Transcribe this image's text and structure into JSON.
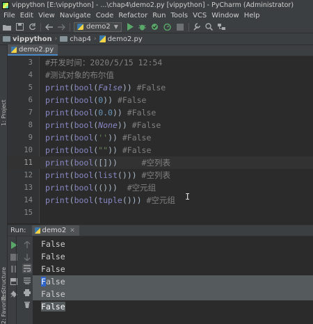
{
  "window": {
    "title": "vippython [E:\\vippython] - ...\\chap4\\demo2.py [vippython] - PyCharm (Administrator)"
  },
  "menu": [
    "File",
    "Edit",
    "View",
    "Navigate",
    "Code",
    "Refactor",
    "Run",
    "Tools",
    "VCS",
    "Window",
    "Help"
  ],
  "toolbar": {
    "run_config": "demo2",
    "icons": [
      "open-folder-icon",
      "save-icon",
      "sync-icon",
      "back-icon",
      "forward-icon",
      "run-icon",
      "debug-icon",
      "coverage-icon",
      "profile-icon",
      "stop-icon",
      "settings-wrench-icon",
      "search-icon",
      "structure-icon"
    ]
  },
  "breadcrumb": [
    "vippython",
    "chap4",
    "demo2.py"
  ],
  "left_strip": {
    "project": "1: Project",
    "structure": "Z: Structure",
    "favorites": "2: Favorites"
  },
  "editor": {
    "tab": "demo2.py",
    "current_line": 11,
    "lines": [
      {
        "n": "3",
        "tokens": [
          [
            "cmt",
            "#开发时间：2020/5/15 12:54"
          ]
        ]
      },
      {
        "n": "4",
        "tokens": [
          [
            "cmt",
            "#测试对象的布尔值"
          ]
        ]
      },
      {
        "n": "5",
        "tokens": [
          [
            "kw-builtin",
            "print"
          ],
          [
            "paren",
            "("
          ],
          [
            "kw-builtin",
            "bool"
          ],
          [
            "paren",
            "("
          ],
          [
            "kw-const",
            "False"
          ],
          [
            "paren",
            "))"
          ],
          [
            "plain",
            " "
          ],
          [
            "cmt",
            "#False"
          ]
        ]
      },
      {
        "n": "6",
        "tokens": [
          [
            "kw-builtin",
            "print"
          ],
          [
            "paren",
            "("
          ],
          [
            "kw-builtin",
            "bool"
          ],
          [
            "paren",
            "("
          ],
          [
            "num",
            "0"
          ],
          [
            "paren",
            "))"
          ],
          [
            "plain",
            " "
          ],
          [
            "cmt",
            "#False"
          ]
        ]
      },
      {
        "n": "7",
        "tokens": [
          [
            "kw-builtin",
            "print"
          ],
          [
            "paren",
            "("
          ],
          [
            "kw-builtin",
            "bool"
          ],
          [
            "paren",
            "("
          ],
          [
            "num",
            "0.0"
          ],
          [
            "paren",
            "))"
          ],
          [
            "plain",
            " "
          ],
          [
            "cmt",
            "#False"
          ]
        ]
      },
      {
        "n": "8",
        "tokens": [
          [
            "kw-builtin",
            "print"
          ],
          [
            "paren",
            "("
          ],
          [
            "kw-builtin",
            "bool"
          ],
          [
            "paren",
            "("
          ],
          [
            "kw-const",
            "None"
          ],
          [
            "paren",
            "))"
          ],
          [
            "plain",
            " "
          ],
          [
            "cmt",
            "#False"
          ]
        ]
      },
      {
        "n": "9",
        "tokens": [
          [
            "kw-builtin",
            "print"
          ],
          [
            "paren",
            "("
          ],
          [
            "kw-builtin",
            "bool"
          ],
          [
            "paren",
            "("
          ],
          [
            "str",
            "''"
          ],
          [
            "paren",
            "))"
          ],
          [
            "plain",
            " "
          ],
          [
            "cmt",
            "#False"
          ]
        ]
      },
      {
        "n": "10",
        "tokens": [
          [
            "kw-builtin",
            "print"
          ],
          [
            "paren",
            "("
          ],
          [
            "kw-builtin",
            "bool"
          ],
          [
            "paren",
            "("
          ],
          [
            "str",
            "\"\""
          ],
          [
            "paren",
            "))"
          ],
          [
            "plain",
            " "
          ],
          [
            "cmt",
            "#False"
          ]
        ]
      },
      {
        "n": "11",
        "tokens": [
          [
            "kw-builtin",
            "print"
          ],
          [
            "paren",
            "("
          ],
          [
            "kw-builtin",
            "bool"
          ],
          [
            "paren",
            "([]))"
          ],
          [
            "plain",
            "     "
          ],
          [
            "cmt",
            "#空列表"
          ]
        ]
      },
      {
        "n": "12",
        "tokens": [
          [
            "kw-builtin",
            "print"
          ],
          [
            "paren",
            "("
          ],
          [
            "kw-builtin",
            "bool"
          ],
          [
            "paren",
            "("
          ],
          [
            "kw-builtin",
            "list"
          ],
          [
            "paren",
            "()))"
          ],
          [
            "plain",
            " "
          ],
          [
            "cmt",
            "#空列表"
          ]
        ]
      },
      {
        "n": "13",
        "tokens": [
          [
            "kw-builtin",
            "print"
          ],
          [
            "paren",
            "("
          ],
          [
            "kw-builtin",
            "bool"
          ],
          [
            "paren",
            "(()))"
          ],
          [
            "plain",
            "  "
          ],
          [
            "cmt",
            "#空元组"
          ]
        ]
      },
      {
        "n": "14",
        "tokens": [
          [
            "kw-builtin",
            "print"
          ],
          [
            "paren",
            "("
          ],
          [
            "kw-builtin",
            "bool"
          ],
          [
            "paren",
            "("
          ],
          [
            "kw-builtin",
            "tuple"
          ],
          [
            "paren",
            "()))"
          ],
          [
            "plain",
            " "
          ],
          [
            "cmt",
            "#空元组"
          ]
        ]
      },
      {
        "n": "15",
        "tokens": []
      }
    ]
  },
  "run": {
    "label": "Run:",
    "tab": "demo2",
    "tools": [
      "rerun-icon",
      "up-arrow-icon",
      "stop-square-icon",
      "down-arrow-icon",
      "pause-icon",
      "soft-wrap-icon",
      "layout-icon",
      "print-icon",
      "pin-icon",
      "trash-icon"
    ],
    "output": [
      {
        "text": "False",
        "selected": false
      },
      {
        "text": "False",
        "selected": false
      },
      {
        "text": "False",
        "selected": false
      },
      {
        "text": "False",
        "selected": true,
        "highlight_first": true
      },
      {
        "text": "False",
        "selected": true
      },
      {
        "text": "False",
        "selected": true,
        "highlight_all": true
      }
    ]
  }
}
